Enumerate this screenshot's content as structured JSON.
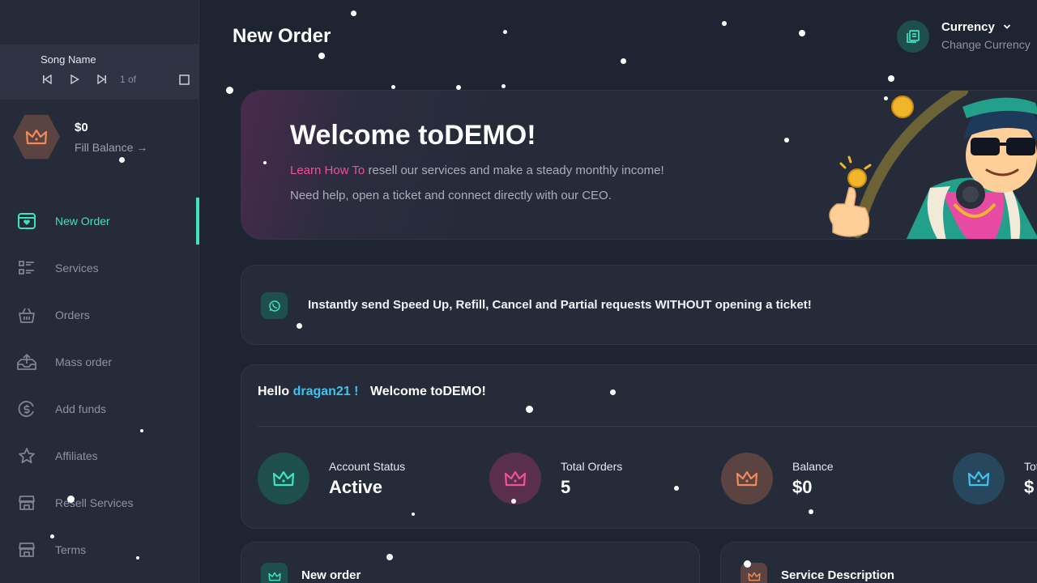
{
  "player": {
    "song_name": "Song Name",
    "position": "1 of"
  },
  "balance": {
    "amount": "$0",
    "fill_label": "Fill Balance →"
  },
  "nav": [
    {
      "label": "New Order",
      "icon": "shop-heart-icon",
      "active": true
    },
    {
      "label": "Services",
      "icon": "list-icon"
    },
    {
      "label": "Orders",
      "icon": "basket-icon"
    },
    {
      "label": "Mass order",
      "icon": "upload-tray-icon"
    },
    {
      "label": "Add funds",
      "icon": "dollar-circle-icon"
    },
    {
      "label": "Affiliates",
      "icon": "star-icon"
    },
    {
      "label": "Resell Services",
      "icon": "store-icon"
    },
    {
      "label": "Terms",
      "icon": "store-icon"
    }
  ],
  "header": {
    "title": "New Order",
    "currency_title": "Currency",
    "currency_sub": "Change Currency"
  },
  "welcome": {
    "title": "Welcome toDEMO!",
    "learn_link": "Learn How To",
    "line1_rest": " resell our services and make a steady monthly income!",
    "line2": "Need help, open a ticket and connect directly with our CEO."
  },
  "strip": {
    "text": "Instantly send Speed Up, Refill, Cancel and Partial requests WITHOUT opening a ticket!"
  },
  "stats": {
    "hello": "Hello",
    "username": "dragan21 !",
    "welcome": "Welcome toDEMO!",
    "items": [
      {
        "label": "Account Status",
        "value": "Active",
        "color": "#3de3c0",
        "bg": "#1e4f4c"
      },
      {
        "label": "Total Orders",
        "value": "5",
        "color": "#ef4f9b",
        "bg": "#5a2f4e"
      },
      {
        "label": "Balance",
        "value": "$0",
        "color": "#ef8a5a",
        "bg": "#5a4340"
      },
      {
        "label": "Tot",
        "value": "$",
        "color": "#3cc3ef",
        "bg": "#27475e"
      }
    ]
  },
  "bottom": {
    "new_order": "New order",
    "service_description": "Service Description"
  },
  "colors": {
    "accent": "#3de3c0",
    "pink": "#ef4f9b",
    "blue": "#3cc3ef",
    "orange": "#ef8a5a",
    "background": "#1f2432",
    "panel": "#262b3a"
  }
}
